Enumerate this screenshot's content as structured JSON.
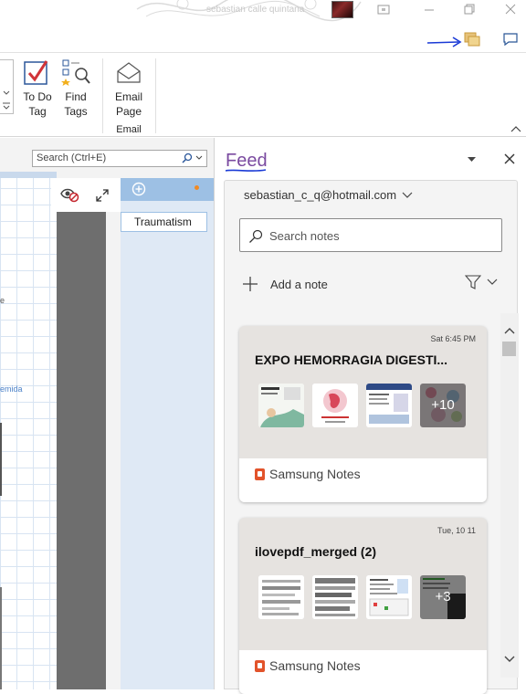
{
  "titlebar": {
    "username": "sebastian calle quintana"
  },
  "ribbon": {
    "todo_line1": "To Do",
    "todo_line2": "Tag",
    "find_line1": "Find",
    "find_line2": "Tags",
    "email_line1": "Email",
    "email_line2": "Page",
    "email_group": "Email"
  },
  "notebook": {
    "search_placeholder": "Search (Ctrl+E)",
    "page_item": "Traumatism",
    "canvas_text_1": "e",
    "canvas_text_2": "emida"
  },
  "feed": {
    "title": "Feed",
    "account": "sebastian_c_q@hotmail.com",
    "search_placeholder": "Search notes",
    "add_note": "Add a note",
    "cards": [
      {
        "date": "Sat 6:45 PM",
        "title": "EXPO HEMORRAGIA DIGESTI...",
        "more_count": "+10",
        "app": "Samsung Notes"
      },
      {
        "date": "Tue, 10 11",
        "title": "ilovepdf_merged (2)",
        "more_count": "+3",
        "app": "Samsung Notes"
      }
    ]
  },
  "colors": {
    "accent_purple": "#7a4aa0",
    "ink_blue": "#1a3ad6",
    "section_blue": "#9dc0e4",
    "samsung_orange": "#e2532b"
  }
}
